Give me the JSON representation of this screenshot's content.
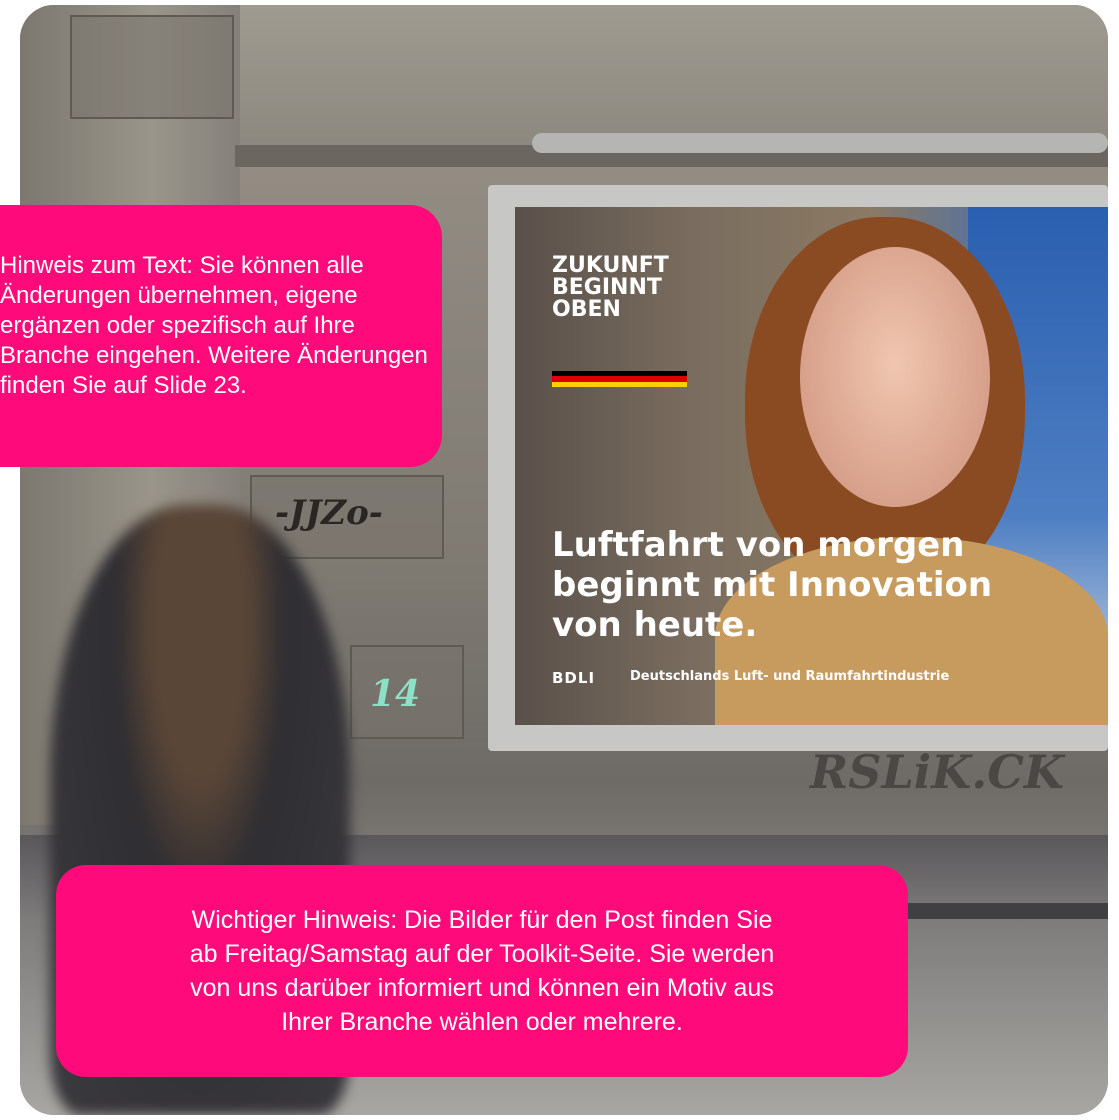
{
  "billboard": {
    "headline": "ZUKUNFT\nBEGINNT\nOBEN",
    "slogan": "Luftfahrt von morgen\nbeginnt mit Innovation\nvon heute.",
    "logo": "BDLI",
    "tagline": "Deutschlands Luft- und Raumfahrtindustrie",
    "flag_colors": [
      "#000000",
      "#dd0000",
      "#ffce00"
    ]
  },
  "graffiti": {
    "tag_1": "-JJZo-",
    "tag_2": "14",
    "tag_3": "RSLiK.CK"
  },
  "callouts": {
    "top": {
      "label": "Hinweis zum Text:",
      "text": "Sie können alle Änderungen übernehmen, eigene ergänzen oder spezifisch auf Ihre Branche eingehen. Weitere Änderungen finden Sie auf Slide 23."
    },
    "bottom": {
      "text": "Wichtiger Hinweis: Die Bilder für den Post finden Sie\nab Freitag/Samstag auf der Toolkit-Seite. Sie werden\nvon uns darüber informiert und können ein Motiv aus\nIhrer Branche wählen oder mehrere."
    }
  },
  "colors": {
    "callout_bg": "#ff0a7a"
  }
}
